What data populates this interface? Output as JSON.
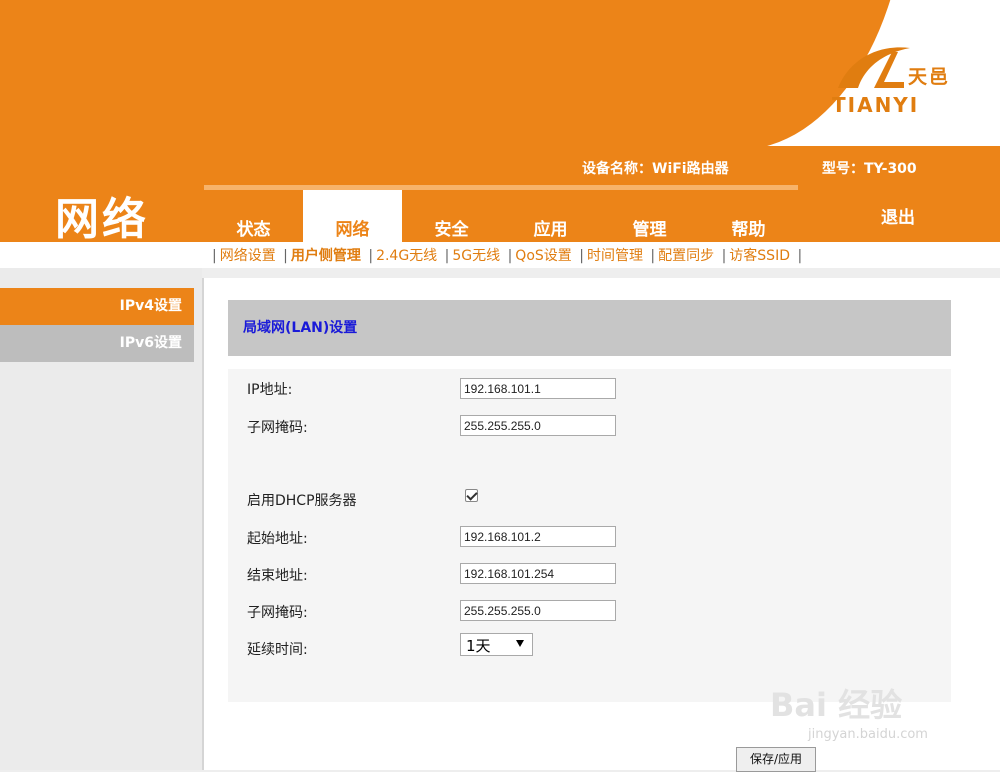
{
  "brand": {
    "logo_cn": "天邑",
    "logo_en": "TIANYI",
    "accent": "#ec8418"
  },
  "header": {
    "section_title": "网络",
    "device_name": "设备名称：WiFi路由器",
    "model": "型号：TY-300",
    "logout": "退出",
    "tabs": [
      {
        "label": "状态",
        "active": false
      },
      {
        "label": "网络",
        "active": true
      },
      {
        "label": "安全",
        "active": false
      },
      {
        "label": "应用",
        "active": false
      },
      {
        "label": "管理",
        "active": false
      },
      {
        "label": "帮助",
        "active": false
      }
    ]
  },
  "submenu": {
    "items": [
      "网络设置",
      "用户侧管理",
      "2.4G无线",
      "5G无线",
      "QoS设置",
      "时间管理",
      "配置同步",
      "访客SSID"
    ],
    "current": "用户侧管理"
  },
  "sidebar": {
    "items": [
      {
        "label": "IPv4设置",
        "active": true
      },
      {
        "label": "IPv6设置",
        "active": false
      }
    ]
  },
  "panel": {
    "title": "局域网(LAN)设置",
    "ip_label": "IP地址:",
    "ip_value": "192.168.101.1",
    "mask_label": "子网掩码:",
    "mask_value": "255.255.255.0",
    "dhcp_label": "启用DHCP服务器",
    "dhcp_enabled": true,
    "start_label": "起始地址:",
    "start_value": "192.168.101.2",
    "end_label": "结束地址:",
    "end_value": "192.168.101.254",
    "dhcp_mask_label": "子网掩码:",
    "dhcp_mask_value": "255.255.255.0",
    "lease_label": "延续时间:",
    "lease_value": "1天",
    "save_label": "保存/应用"
  },
  "watermark": {
    "text": "Bai 经验",
    "sub": "jingyan.baidu.com"
  }
}
